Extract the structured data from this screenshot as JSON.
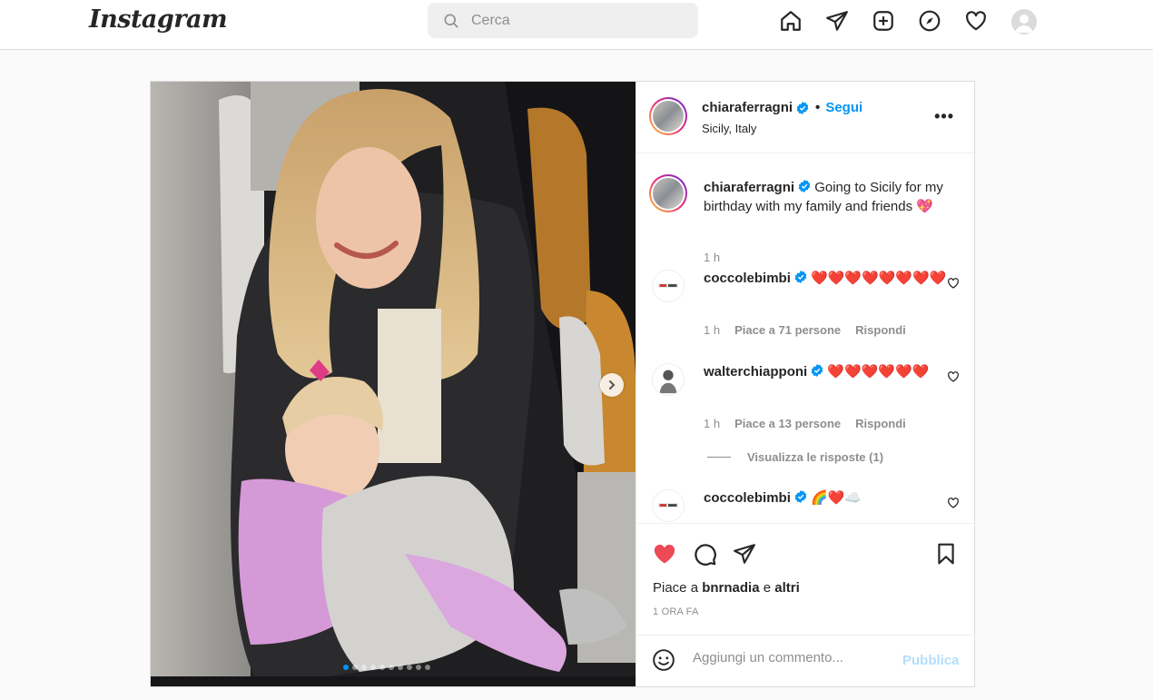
{
  "nav": {
    "logo": "Instagram",
    "search_placeholder": "Cerca",
    "icons": [
      "home-icon",
      "direct-icon",
      "new-post-icon",
      "explore-icon",
      "activity-icon",
      "profile-avatar"
    ]
  },
  "post": {
    "author": "chiaraferragni",
    "follow_label": "Segui",
    "location": "Sicily, Italy",
    "more_label": "•••",
    "carousel": {
      "count": 10,
      "active_index": 0
    },
    "caption": {
      "user": "chiaraferragni",
      "text": "Going to Sicily for my birthday with my family and friends 💖",
      "time": "1 h"
    },
    "comments": [
      {
        "user": "coccolebimbi",
        "text": "❤️❤️❤️❤️❤️❤️❤️❤️",
        "time": "1 h",
        "likes": "Piace a 71 persone",
        "reply": "Rispondi"
      },
      {
        "user": "walterchiapponi",
        "text": "❤️❤️❤️❤️❤️❤️",
        "time": "1 h",
        "likes": "Piace a 13 persone",
        "reply": "Rispondi",
        "view_replies": "Visualizza le risposte (1)"
      },
      {
        "user": "coccolebimbi",
        "text": "🌈❤️☁️"
      }
    ],
    "likes_prefix": "Piace a",
    "likes_user": "bnrnadia",
    "likes_joiner": "e",
    "likes_others": "altri",
    "time_ago": "1 ORA FA",
    "comment_placeholder": "Aggiungi un commento...",
    "publish_label": "Pubblica"
  },
  "colors": {
    "accent": "#0095f6",
    "like_red": "#ed4956",
    "publish_disabled": "#b2dffc",
    "muted": "#8e8e8e"
  }
}
